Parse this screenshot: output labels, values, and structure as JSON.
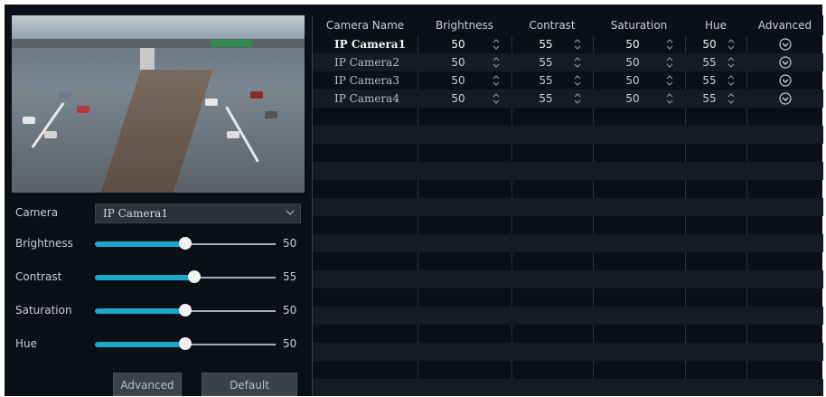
{
  "left_panel": {
    "camera": {
      "label": "Camera",
      "selected": "IP Camera1"
    },
    "sliders": [
      {
        "label": "Brightness",
        "value": "50",
        "level": 0.5
      },
      {
        "label": "Contrast",
        "value": "55",
        "level": 0.55
      },
      {
        "label": "Saturation",
        "value": "50",
        "level": 0.5
      },
      {
        "label": "Hue",
        "value": "50",
        "level": 0.5
      }
    ],
    "buttons": {
      "advanced": "Advanced",
      "default": "Default"
    }
  },
  "table": {
    "columns": [
      "Camera Name",
      "Brightness",
      "Contrast",
      "Saturation",
      "Hue",
      "Advanced"
    ],
    "rows": [
      {
        "name": "IP Camera1",
        "brightness": "50",
        "contrast": "55",
        "saturation": "50",
        "hue": "50"
      },
      {
        "name": "IP Camera2",
        "brightness": "50",
        "contrast": "55",
        "saturation": "50",
        "hue": "55"
      },
      {
        "name": "IP Camera3",
        "brightness": "50",
        "contrast": "55",
        "saturation": "50",
        "hue": "55"
      },
      {
        "name": "IP Camera4",
        "brightness": "50",
        "contrast": "55",
        "saturation": "50",
        "hue": "55"
      }
    ]
  },
  "colors": {
    "accent": "#1aa7c9",
    "background": "#0b0f16",
    "row_alt": "#161b23"
  }
}
